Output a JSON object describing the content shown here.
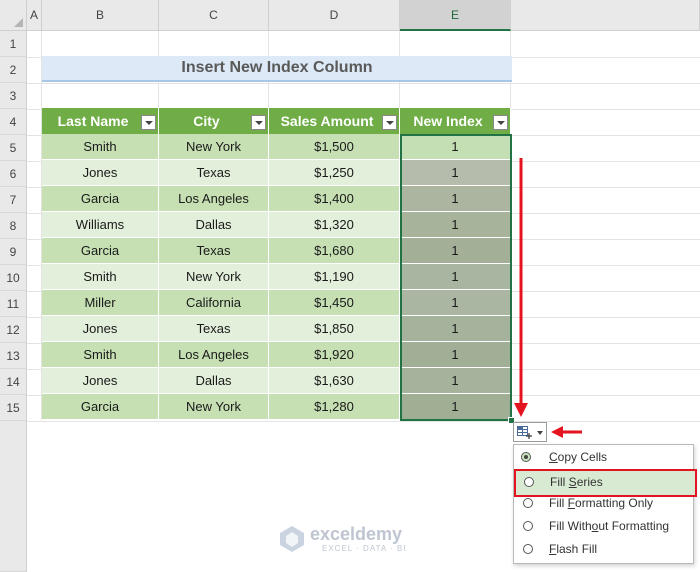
{
  "columns": [
    "A",
    "B",
    "C",
    "D",
    "E"
  ],
  "rows": [
    "1",
    "2",
    "3",
    "4",
    "5",
    "6",
    "7",
    "8",
    "9",
    "10",
    "11",
    "12",
    "13",
    "14",
    "15"
  ],
  "title": "Insert New Index Column",
  "headers": [
    "Last Name",
    "City",
    "Sales Amount",
    "New Index"
  ],
  "table": [
    [
      "Smith",
      "New York",
      "$1,500",
      "1"
    ],
    [
      "Jones",
      "Texas",
      "$1,250",
      "1"
    ],
    [
      "Garcia",
      "Los Angeles",
      "$1,400",
      "1"
    ],
    [
      "Williams",
      "Dallas",
      "$1,320",
      "1"
    ],
    [
      "Garcia",
      "Texas",
      "$1,680",
      "1"
    ],
    [
      "Smith",
      "New York",
      "$1,190",
      "1"
    ],
    [
      "Miller",
      "California",
      "$1,450",
      "1"
    ],
    [
      "Jones",
      "Texas",
      "$1,850",
      "1"
    ],
    [
      "Smith",
      "Los Angeles",
      "$1,920",
      "1"
    ],
    [
      "Jones",
      "Dallas",
      "$1,630",
      "1"
    ],
    [
      "Garcia",
      "New York",
      "$1,280",
      "1"
    ]
  ],
  "menu": {
    "items": [
      {
        "label": "Copy Cells",
        "icon": "radio-button",
        "selected_radio": true
      },
      {
        "label": "Fill Series",
        "icon": "radio-button",
        "selected_radio": false,
        "highlighted": true
      },
      {
        "label": "Fill Formatting Only",
        "icon": "radio-button",
        "selected_radio": false
      },
      {
        "label": "Fill Without Formatting",
        "icon": "radio-button",
        "selected_radio": false
      },
      {
        "label": "Flash Fill",
        "icon": "radio-button",
        "selected_radio": false
      }
    ]
  },
  "watermark": {
    "name": "exceldemy",
    "tagline": "EXCEL · DATA · BI"
  },
  "colors": {
    "header_green": "#70ad47",
    "row_dark": "#c6e0b4",
    "row_light": "#e2efda",
    "selection": "#217346",
    "annotation_red": "#e3141f",
    "title_fill": "#dde9f6"
  }
}
